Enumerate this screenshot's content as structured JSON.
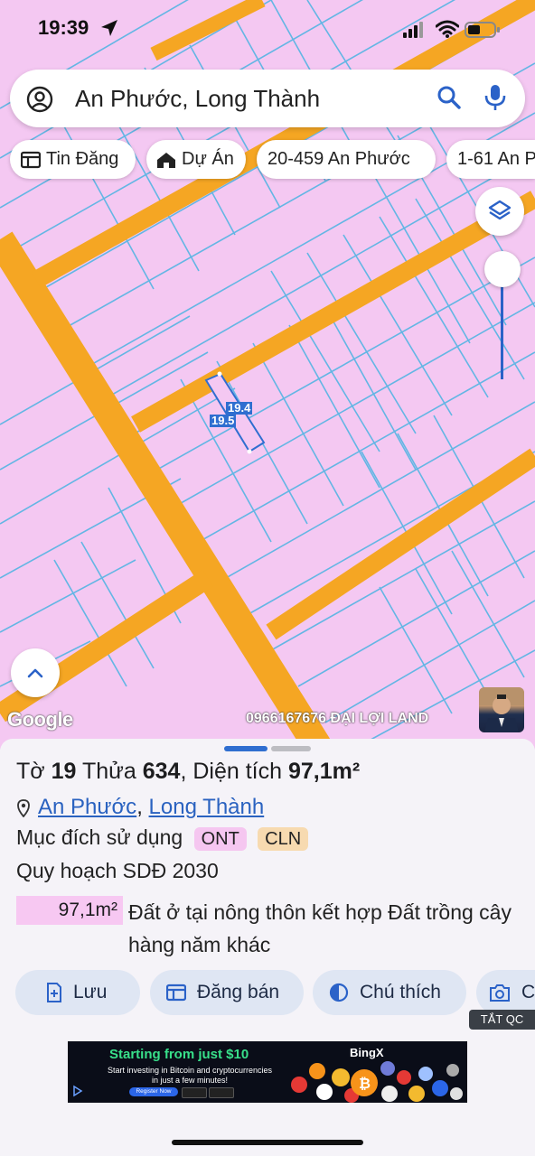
{
  "status_bar": {
    "time": "19:39"
  },
  "search": {
    "query": "An Phước, Long Thành"
  },
  "chips": [
    {
      "label": "Tin Đăng",
      "icon": "newspaper-icon"
    },
    {
      "label": "Dự Án",
      "icon": "house-icon"
    },
    {
      "label": "20-459 An Phước"
    },
    {
      "label": "1-61 An P"
    }
  ],
  "map": {
    "dimension_labels": [
      "19.4",
      "19.5"
    ],
    "google_logo": "Google",
    "watermark": "0966167676 ĐẠI LỢI LAND",
    "colors": {
      "land": "#f4c8f2",
      "road": "#f5a623",
      "parcel_line": "#63b6e4",
      "selected_parcel": "#2f6ed0"
    }
  },
  "parcel": {
    "title_prefix": "Tờ",
    "sheet_no": "19",
    "plot_label": "Thửa",
    "plot_no": "634",
    "area_label": ", Diện tích",
    "area": "97,1m²",
    "address": {
      "ward": "An Phước",
      "district": "Long Thành",
      "separator": ","
    },
    "usage_label": "Mục đích sử dụng",
    "usage_tags": [
      "ONT",
      "CLN"
    ],
    "plan_label": "Quy hoạch SDĐ 2030",
    "plan_area": "97,1m²",
    "plan_description": "Đất ở tại nông thôn kết hợp Đất trồng cây hàng năm khác"
  },
  "actions": {
    "save": "Lưu",
    "post_sale": "Đăng bán",
    "legend": "Chú thích",
    "photo": "C"
  },
  "ad": {
    "close_label": "TẮT QC",
    "headline": "Starting from just $10",
    "subtext": "Start investing in Bitcoin and cryptocurrencies in just a few minutes!",
    "cta": "Register Now",
    "brand": "BingX"
  }
}
